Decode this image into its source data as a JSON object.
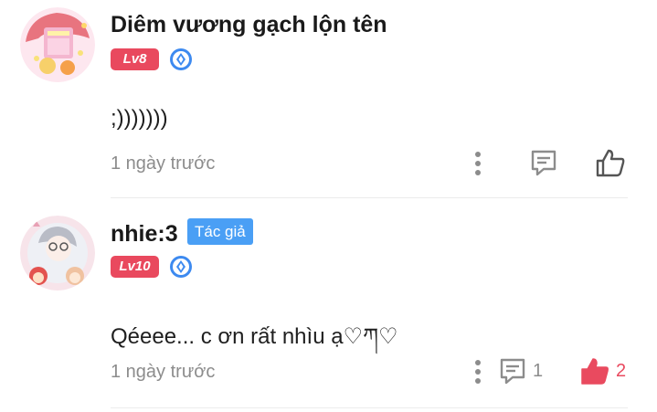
{
  "comments": [
    {
      "username": "Diêm vương gạch lộn tên",
      "level": "Lv8",
      "text": ";)))))))",
      "time": "1 ngày trước",
      "reply_count": "",
      "like_count": "",
      "liked": false
    },
    {
      "username": "nhie:3",
      "author_badge": "Tác giả",
      "level": "Lv10",
      "text": "Qéeee... c ơn rất nhìu ạ♡ཀ♡",
      "time": "1 ngày trước",
      "reply_count": "1",
      "like_count": "2",
      "liked": true
    }
  ],
  "colors": {
    "level_badge": "#e9495e",
    "author_badge": "#4a9ff5",
    "like_active": "#e94a5f",
    "muted": "#8c8c8c",
    "rank_icon": "#3d8af0"
  },
  "icons": [
    "rank-diamond-icon",
    "more-vertical-icon",
    "comment-icon",
    "thumbs-up-icon"
  ]
}
